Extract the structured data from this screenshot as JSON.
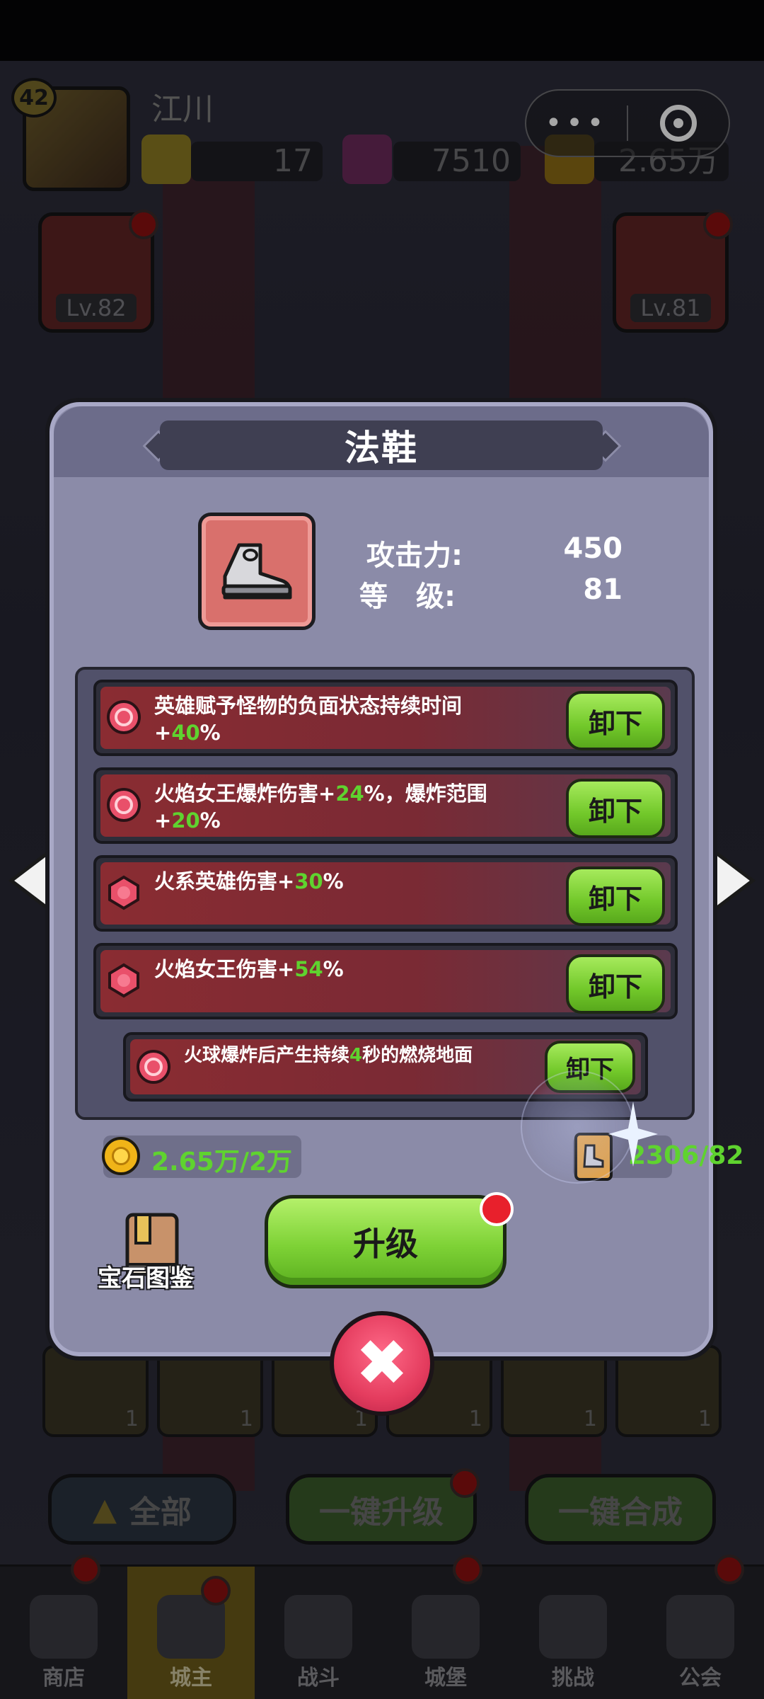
{
  "player": {
    "level": "42",
    "name": "江川"
  },
  "resources": {
    "gold_gems": "17",
    "purple_gems": "7510",
    "coins": "2.65万"
  },
  "wechat_capsule": {
    "more_glyph": "•••"
  },
  "heroes": {
    "left_level": "Lv.82",
    "right_level": "Lv.81"
  },
  "inventory_counts": [
    "1",
    "1",
    "1",
    "1",
    "1",
    "1"
  ],
  "bg_buttons": {
    "all": "全部",
    "one_click_upgrade": "一键升级",
    "one_click_merge": "一键合成"
  },
  "bottom_nav": [
    {
      "label": "商店"
    },
    {
      "label": "城主"
    },
    {
      "label": "战斗"
    },
    {
      "label": "城堡"
    },
    {
      "label": "挑战"
    },
    {
      "label": "公会"
    }
  ],
  "modal": {
    "title": "法鞋",
    "attack_label": "攻击力:",
    "attack_value": "450",
    "level_label": "等　级:",
    "level_value": "81",
    "gems": [
      {
        "prefix": "英雄赋予怪物的负面状态持续时间+",
        "value": "40",
        "mid": "",
        "value2": "",
        "suffix": "%",
        "button": "卸下"
      },
      {
        "prefix": "火焰女王爆炸伤害+",
        "value": "24",
        "mid": "%，爆炸范围+",
        "value2": "20",
        "suffix": "%",
        "button": "卸下"
      },
      {
        "prefix": "火系英雄伤害+",
        "value": "30",
        "mid": "",
        "value2": "",
        "suffix": "%",
        "button": "卸下"
      },
      {
        "prefix": "火焰女王伤害+",
        "value": "54",
        "mid": "",
        "value2": "",
        "suffix": "%",
        "button": "卸下"
      },
      {
        "prefix": "火球爆炸后产生持续",
        "value": "4",
        "mid": "秒的燃烧地面",
        "value2": "",
        "suffix": "",
        "button": "卸下"
      }
    ],
    "coin_cost": "2.65万/2万",
    "scroll_cost": "2306/82",
    "gem_book_label": "宝石图鉴",
    "upgrade_label": "升级",
    "close_glyph": "✖"
  },
  "colors": {
    "highlight_green": "#5fd32f",
    "button_green": "#7ed236",
    "close_red": "#e43c5e",
    "panel_purple": "#8b8ba8"
  }
}
